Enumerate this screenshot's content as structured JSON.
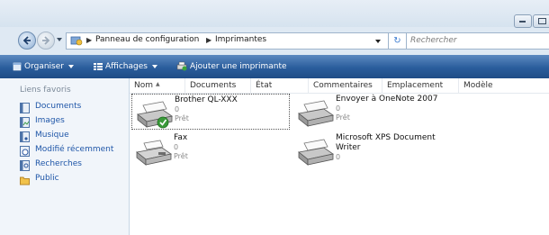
{
  "address": {
    "crumbs": [
      "Panneau de configuration",
      "Imprimantes"
    ],
    "search_placeholder": "Rechercher"
  },
  "toolbar": {
    "organize_label": "Organiser",
    "views_label": "Affichages",
    "add_printer_label": "Ajouter une imprimante"
  },
  "sidebar": {
    "heading": "Liens favoris",
    "items": [
      {
        "label": "Documents",
        "icon": "documents-icon"
      },
      {
        "label": "Images",
        "icon": "images-icon"
      },
      {
        "label": "Musique",
        "icon": "music-icon"
      },
      {
        "label": "Modifié récemment",
        "icon": "recent-icon"
      },
      {
        "label": "Recherches",
        "icon": "searches-icon"
      },
      {
        "label": "Public",
        "icon": "public-folder-icon"
      }
    ]
  },
  "columns": [
    "Nom",
    "Documents",
    "État",
    "Commentaires",
    "Emplacement",
    "Modèle"
  ],
  "printers": [
    {
      "name": "Brother QL-XXX",
      "count": "0",
      "status": "Prêt",
      "default": true,
      "selected": true
    },
    {
      "name": "Envoyer à OneNote 2007",
      "count": "0",
      "status": "Prêt",
      "default": false,
      "selected": false
    },
    {
      "name": "Fax",
      "count": "0",
      "status": "Prêt",
      "default": false,
      "selected": false
    },
    {
      "name": "Microsoft XPS Document",
      "name2": "Writer",
      "count": "0",
      "default": false,
      "selected": false
    }
  ],
  "colors": {
    "toolbar": "#2a5d9c",
    "link": "#1f56a8",
    "sidebar_bg": "#f1f5fa"
  }
}
